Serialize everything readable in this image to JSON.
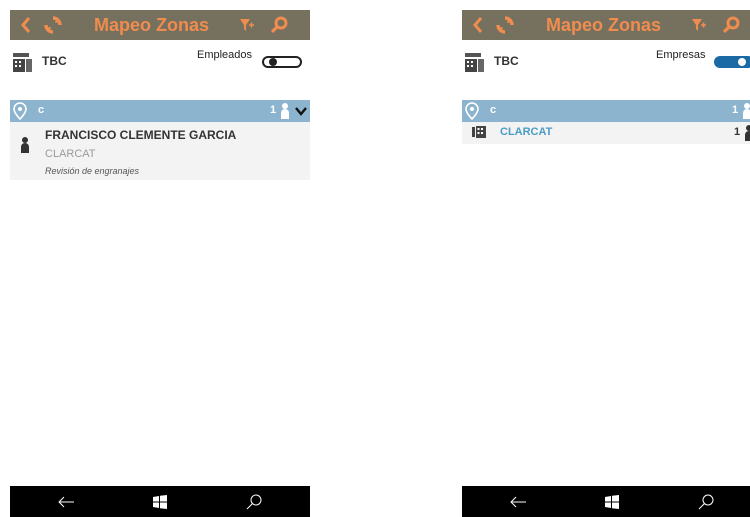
{
  "app": {
    "title": "Mapeo Zonas"
  },
  "colors": {
    "header_bg": "#76705f",
    "accent": "#f08c4e",
    "zone_bar": "#8cb4cf",
    "toggle_on": "#1c6aa5",
    "company_link": "#4a9bc6"
  },
  "icons": {
    "back": "back-chevron-icon",
    "sync": "sync-icon",
    "filter": "filter-icon",
    "search": "search-icon",
    "company": "building-icon",
    "zone": "location-pin-icon",
    "person": "person-icon",
    "expand": "chevron-down-icon",
    "nav_back": "nav-back-arrow-icon",
    "nav_home": "windows-logo-icon",
    "nav_search": "nav-search-icon"
  },
  "left": {
    "company": "TBC",
    "toggle_label": "Empleados",
    "toggle_on": false,
    "zone": {
      "name": "c",
      "count": "1"
    },
    "employee": {
      "name": "FRANCISCO CLEMENTE GARCIA",
      "company": "CLARCAT",
      "task": "Revisión de engranajes"
    }
  },
  "right": {
    "company": "TBC",
    "toggle_label": "Empresas",
    "toggle_on": true,
    "zone": {
      "name": "c",
      "count": "1"
    },
    "entry": {
      "name": "CLARCAT",
      "count": "1"
    }
  }
}
